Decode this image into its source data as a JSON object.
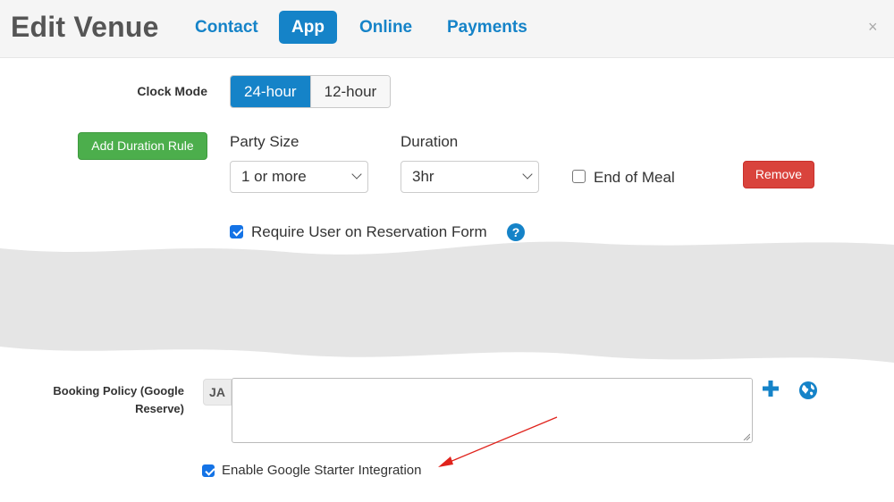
{
  "header": {
    "title": "Edit Venue",
    "tabs": [
      {
        "label": "Contact"
      },
      {
        "label": "App"
      },
      {
        "label": "Online"
      },
      {
        "label": "Payments"
      }
    ],
    "close_icon": "×"
  },
  "clock_mode": {
    "label": "Clock Mode",
    "options": [
      "24-hour",
      "12-hour"
    ],
    "selected": "24-hour"
  },
  "duration_rule": {
    "add_label": "Add Duration Rule",
    "party_size_label": "Party Size",
    "party_size_value": "1 or more",
    "duration_label": "Duration",
    "duration_value": "3hr",
    "end_of_meal_label": "End of Meal",
    "end_of_meal_checked": false,
    "remove_label": "Remove"
  },
  "require_user": {
    "label": "Require User on Reservation Form",
    "checked": true,
    "help_icon": "?"
  },
  "booking_policy": {
    "label_line1": "Booking Policy (Google",
    "label_line2": "Reserve)",
    "lang_badge": "JA",
    "value": "",
    "add_icon": "plus-icon",
    "language_icon": "globe-icon"
  },
  "google_starter": {
    "label": "Enable Google Starter Integration",
    "checked": true
  },
  "colors": {
    "accent": "#1583c8",
    "success": "#4cae4c",
    "danger": "#d9433c",
    "annotation": "#e0231c"
  }
}
